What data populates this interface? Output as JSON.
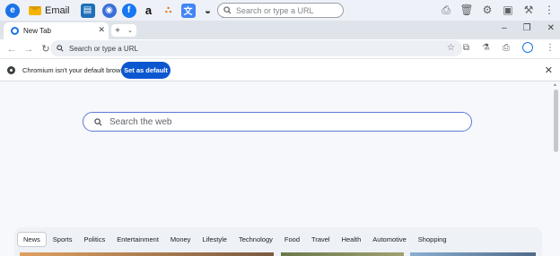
{
  "taskbar": {
    "email_label": "Email",
    "search_placeholder": "Search or type a URL",
    "pinned_icons": [
      "edge-icon",
      "email-icon",
      "news-icon",
      "globe-icon",
      "facebook-icon",
      "amazon-icon",
      "dots-icon",
      "translate-icon",
      "gamepad-icon",
      "calculator-icon"
    ]
  },
  "tabs": [
    {
      "label": "New Tab",
      "active": true
    }
  ],
  "toolbar": {
    "omnibox_placeholder": "Search or type a URL"
  },
  "infobar": {
    "message": "Chromium isn't your default browser",
    "button_label": "Set as default"
  },
  "newtab": {
    "search_placeholder": "Search the web",
    "categories": [
      "News",
      "Sports",
      "Politics",
      "Entertainment",
      "Money",
      "Lifestyle",
      "Technology",
      "Food",
      "Travel",
      "Health",
      "Automotive",
      "Shopping"
    ],
    "active_category": "News"
  },
  "colors": {
    "accent": "#0b57d0",
    "page_bg": "#f6f8fc"
  }
}
